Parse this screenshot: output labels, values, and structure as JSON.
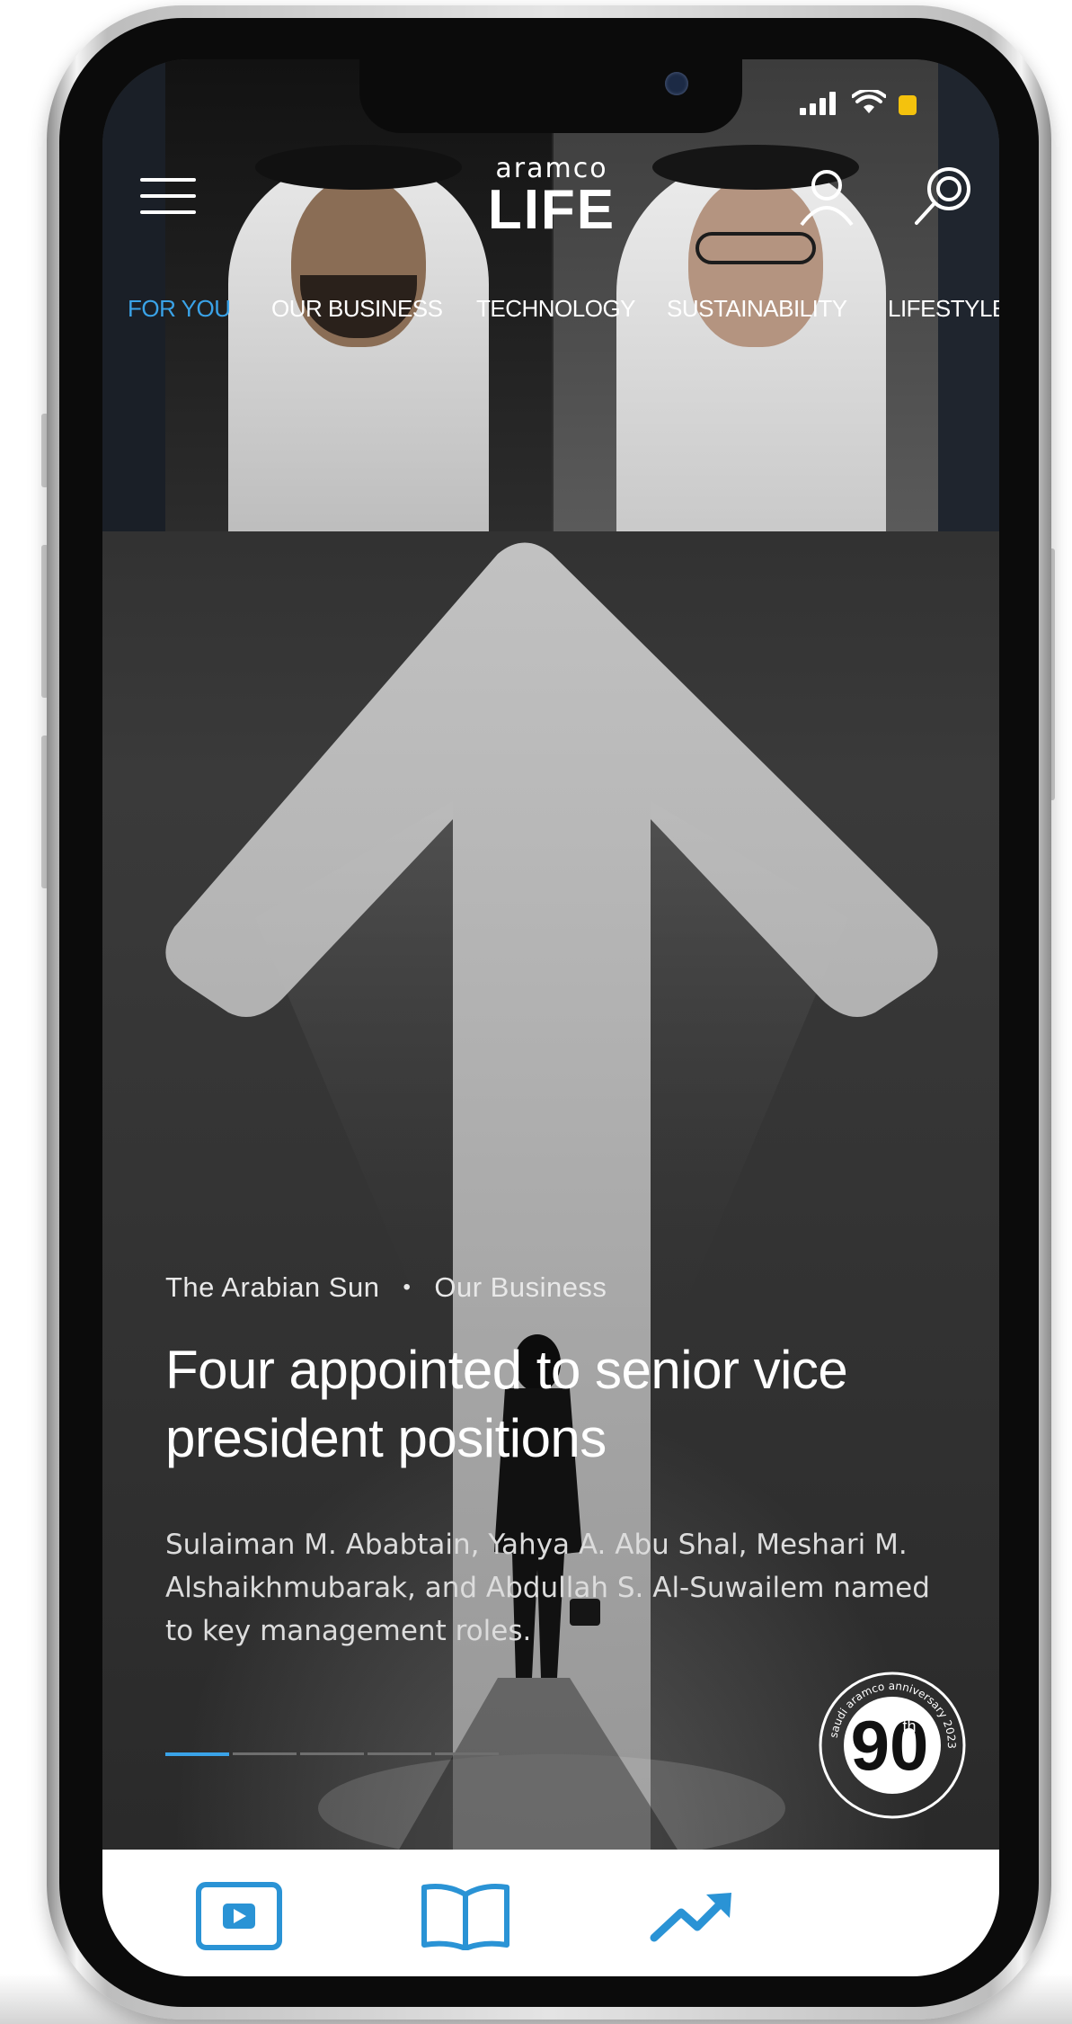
{
  "status_bar": {
    "signal_icon": "signal-bars-icon",
    "wifi_icon": "wifi-icon",
    "battery_icon": "battery-low-icon",
    "battery_color": "#f4c20d"
  },
  "header": {
    "logo_top": "aramco",
    "logo_main": "LIFE",
    "menu_icon": "hamburger-menu-icon",
    "profile_icon": "user-profile-icon",
    "search_icon": "search-icon"
  },
  "nav": {
    "active_color": "#3aa3e8",
    "tabs": [
      {
        "label": "FOR YOU",
        "active": true
      },
      {
        "label": "OUR BUSINESS",
        "active": false
      },
      {
        "label": "TECHNOLOGY",
        "active": false
      },
      {
        "label": "SUSTAINABILITY",
        "active": false
      },
      {
        "label": "LIFESTYLE",
        "active": false
      }
    ]
  },
  "article": {
    "source": "The Arabian Sun",
    "separator": "•",
    "category": "Our Business",
    "headline": "Four appointed to senior vice president positions",
    "summary": "Sulaiman M. Ababtain, Yahya A. Abu Shal, Meshari M. Alshaikhmubarak, and Abdullah S. Al-Suwailem named to key management roles."
  },
  "carousel": {
    "slide_count": 5,
    "active_index": 0
  },
  "badge": {
    "ring_text": "saudi aramco anniversary 2023",
    "number": "90",
    "suffix": "th"
  },
  "bottom_nav": {
    "accent": "#2a93d5",
    "items": [
      {
        "icon": "video-play-icon"
      },
      {
        "icon": "open-book-icon"
      },
      {
        "icon": "trending-up-icon"
      }
    ]
  }
}
